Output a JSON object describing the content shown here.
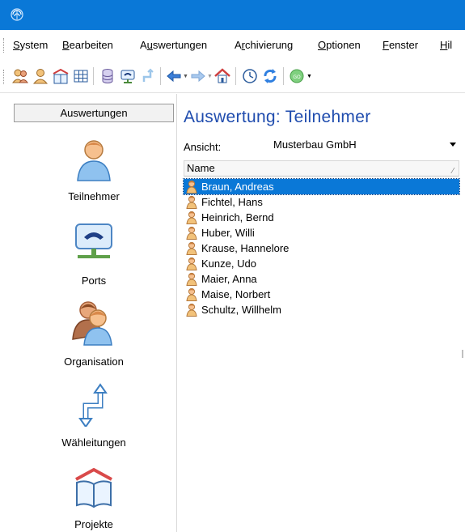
{
  "menu": {
    "items": [
      {
        "pre": "",
        "ul": "S",
        "post": "ystem"
      },
      {
        "pre": "",
        "ul": "B",
        "post": "earbeiten"
      },
      {
        "pre": "A",
        "ul": "u",
        "post": "swertungen"
      },
      {
        "pre": "A",
        "ul": "r",
        "post": "chivierung"
      },
      {
        "pre": "",
        "ul": "O",
        "post": "ptionen"
      },
      {
        "pre": "",
        "ul": "F",
        "post": "enster"
      },
      {
        "pre": "",
        "ul": "H",
        "post": "il"
      }
    ]
  },
  "sidebar": {
    "header": "Auswertungen",
    "items": [
      {
        "label": "Teilnehmer",
        "icon": "person-icon"
      },
      {
        "label": "Ports",
        "icon": "phone-port-icon"
      },
      {
        "label": "Organisation",
        "icon": "group-icon"
      },
      {
        "label": "Wähleitungen",
        "icon": "route-arrows-icon"
      },
      {
        "label": "Projekte",
        "icon": "book-icon"
      }
    ]
  },
  "main": {
    "title": "Auswertung: Teilnehmer",
    "view_label": "Ansicht:",
    "view_value": "Musterbau GmbH",
    "column_header": "Name",
    "rows": [
      "Braun, Andreas",
      "Fichtel, Hans",
      "Heinrich, Bernd",
      "Huber, Willi",
      "Krause, Hannelore",
      "Kunze, Udo",
      "Maier, Anna",
      "Maise, Norbert",
      "Schultz, Willhelm"
    ],
    "selected_index": 0
  },
  "colors": {
    "titlebar": "#0a78d7",
    "title_text": "#1f4cae",
    "selection": "#0a78d7"
  }
}
